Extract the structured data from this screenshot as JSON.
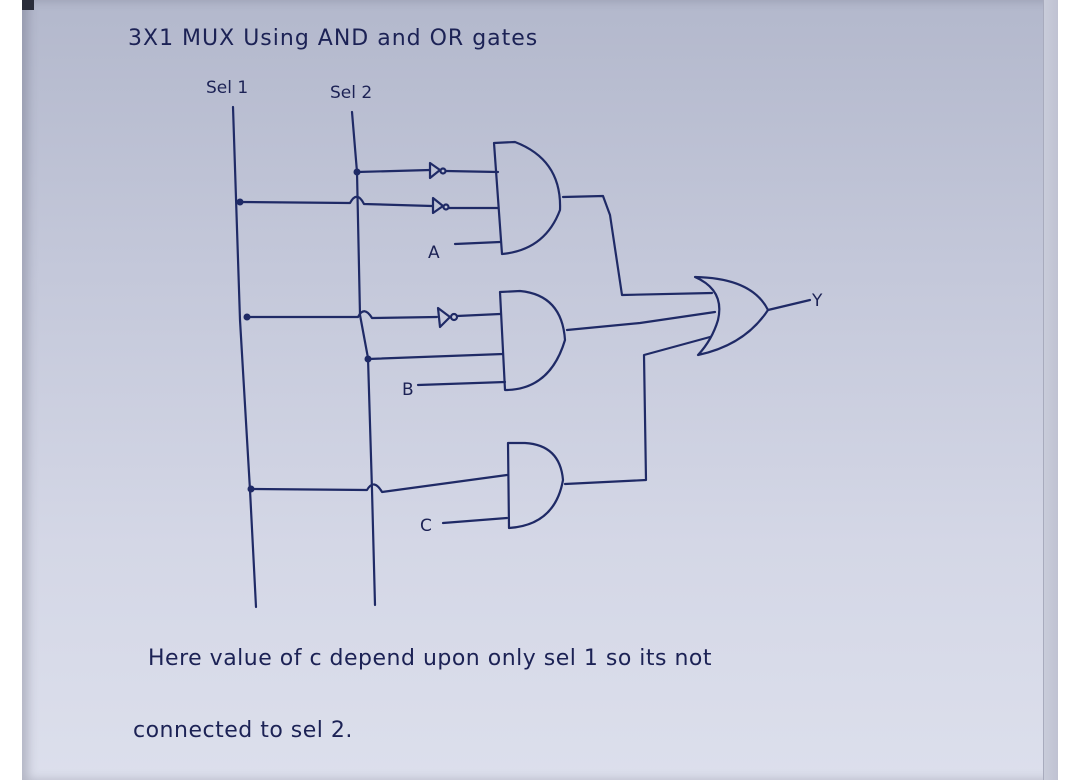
{
  "title": "3X1 MUX Using AND and OR gates",
  "select_lines": [
    {
      "label": "Sel 1"
    },
    {
      "label": "Sel 2"
    }
  ],
  "inputs": [
    {
      "label": "A"
    },
    {
      "label": "B"
    },
    {
      "label": "C"
    }
  ],
  "output": {
    "label": "Y"
  },
  "gates": {
    "and_gates": [
      {
        "inputs": [
          "NOT Sel 2",
          "NOT Sel 1",
          "A"
        ]
      },
      {
        "inputs": [
          "NOT Sel 1",
          "Sel 2",
          "B"
        ]
      },
      {
        "inputs": [
          "Sel 1",
          "C"
        ]
      }
    ],
    "or_gate": {
      "inputs": [
        "AND1",
        "AND2",
        "AND3"
      ],
      "output": "Y"
    }
  },
  "note": {
    "line1": "Here value of c depend upon only sel 1 so its not",
    "line2": "connected to sel 2."
  },
  "colors": {
    "ink": "#1f2a66",
    "paper": "#c4c8da"
  }
}
